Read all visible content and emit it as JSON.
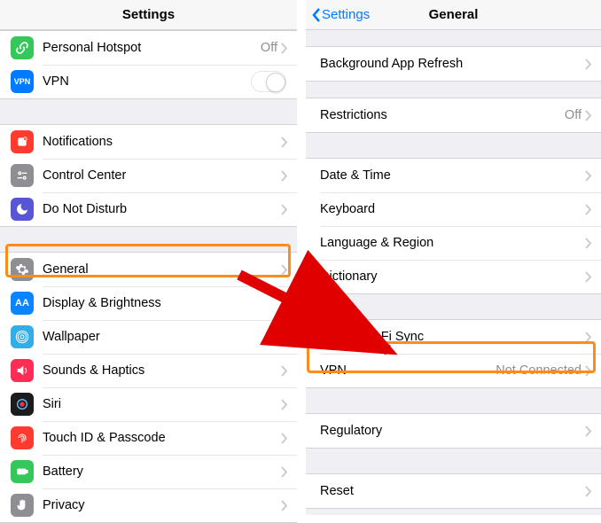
{
  "left": {
    "title": "Settings",
    "g1": {
      "hotspot": {
        "label": "Personal Hotspot",
        "value": "Off"
      },
      "vpn": {
        "label": "VPN"
      }
    },
    "g2": {
      "notifications": {
        "label": "Notifications"
      },
      "control": {
        "label": "Control Center"
      },
      "dnd": {
        "label": "Do Not Disturb"
      }
    },
    "g3": {
      "general": {
        "label": "General"
      },
      "display": {
        "label": "Display & Brightness"
      },
      "wallpaper": {
        "label": "Wallpaper"
      },
      "sounds": {
        "label": "Sounds & Haptics"
      },
      "siri": {
        "label": "Siri"
      },
      "touchid": {
        "label": "Touch ID & Passcode"
      },
      "battery": {
        "label": "Battery"
      },
      "privacy": {
        "label": "Privacy"
      }
    }
  },
  "right": {
    "back": "Settings",
    "title": "General",
    "g1": {
      "bgrefresh": {
        "label": "Background App Refresh"
      }
    },
    "g2": {
      "restrictions": {
        "label": "Restrictions",
        "value": "Off"
      }
    },
    "g3": {
      "datetime": {
        "label": "Date & Time"
      },
      "keyboard": {
        "label": "Keyboard"
      },
      "language": {
        "label": "Language & Region"
      },
      "dictionary": {
        "label": "Dictionary"
      }
    },
    "g4": {
      "wifisync": {
        "label": "iTunes Wi-Fi Sync"
      },
      "vpn": {
        "label": "VPN",
        "value": "Not Connected"
      }
    },
    "g5": {
      "regulatory": {
        "label": "Regulatory"
      }
    },
    "g6": {
      "reset": {
        "label": "Reset"
      }
    }
  }
}
